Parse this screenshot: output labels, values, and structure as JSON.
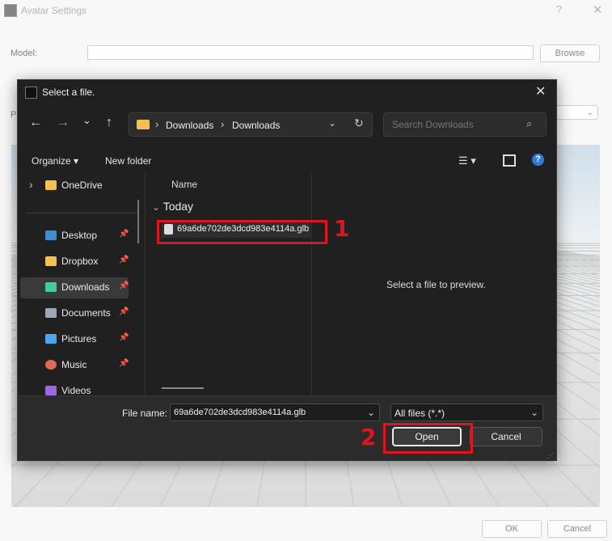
{
  "background_window": {
    "title": "Avatar Settings",
    "help": "?",
    "close": "✕",
    "model_label": "Model:",
    "model_value": "",
    "browse_label": "Browse",
    "partial_label": "P",
    "select_value": "⌄",
    "ok_label": "OK",
    "cancel_label": "Cancel"
  },
  "dialog": {
    "title": "Select a file.",
    "close": "✕",
    "nav": {
      "back": "←",
      "forward": "→",
      "recent": "⌄",
      "up": "↑"
    },
    "breadcrumb": [
      "Downloads",
      "Downloads"
    ],
    "breadcrumb_sep": "›",
    "address_dropdown": "⌄",
    "refresh": "↻",
    "search_placeholder": "Search Downloads",
    "search_icon": "⌕",
    "toolbar": {
      "organize": "Organize ▾",
      "new_folder": "New folder",
      "view_icon": "☰ ▾",
      "help_icon": "?"
    },
    "sidebar": {
      "onedrive": {
        "label": "OneDrive",
        "expander": "›",
        "icon_color": "#f2c14e"
      },
      "items": [
        {
          "label": "Desktop",
          "icon_color": "#3e8ed0"
        },
        {
          "label": "Dropbox",
          "icon_color": "#f2c14e"
        },
        {
          "label": "Downloads",
          "icon_color": "#3ecfa0",
          "selected": true
        },
        {
          "label": "Documents",
          "icon_color": "#9aa7b4"
        },
        {
          "label": "Pictures",
          "icon_color": "#4aa8e8"
        },
        {
          "label": "Music",
          "icon_color": "#e06a5a"
        },
        {
          "label": "Videos",
          "icon_color": "#9b6ae0"
        }
      ],
      "pin_icon": "📌"
    },
    "file_list": {
      "column_name": "Name",
      "group": "Today",
      "group_chevron": "⌄",
      "files": [
        "69a6de702de3dcd983e4114a.glb"
      ]
    },
    "preview_text": "Select a file to preview.",
    "file_name_label": "File name:",
    "file_name_value": "69a6de702de3dcd983e4114a.glb",
    "file_type_value": "All files (*.*)",
    "dropdown_glyph": "⌄",
    "open_label": "Open",
    "cancel_label": "Cancel",
    "grip": "⋰"
  },
  "annotations": {
    "step1": "1",
    "step2": "2",
    "color": "#e0141e"
  }
}
